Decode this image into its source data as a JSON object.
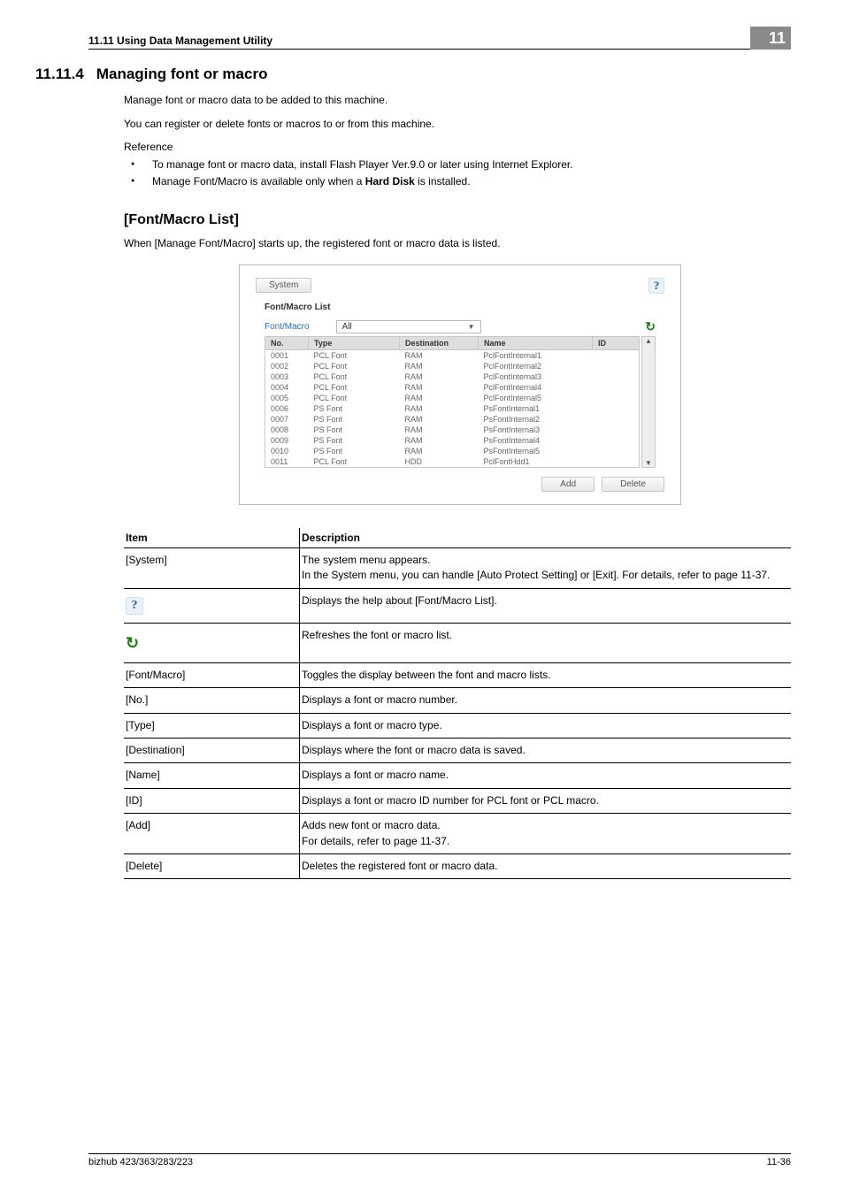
{
  "header": {
    "left": "11.11    Using Data Management Utility",
    "chip": "11"
  },
  "section": {
    "number": "11.11.4",
    "title": "Managing font or macro",
    "p1": "Manage font or macro data to be added to this machine.",
    "p2": "You can register or delete fonts or macros to or from this machine.",
    "ref_label": "Reference",
    "bul1": "To manage font or macro data, install Flash Player Ver.9.0 or later using Internet Explorer.",
    "bul2_a": "Manage Font/Macro is available only when a ",
    "bul2_b": "Hard Disk",
    "bul2_c": " is installed."
  },
  "subsection": {
    "title": "[Font/Macro List]",
    "p": "When [Manage Font/Macro] starts up, the registered font or macro data is listed."
  },
  "shot": {
    "system_btn": "System",
    "title": "Font/Macro List",
    "filter_link": "Font/Macro",
    "filter_value": "All",
    "add_btn": "Add",
    "del_btn": "Delete",
    "cols": {
      "no": "No.",
      "type": "Type",
      "dest": "Destination",
      "name": "Name",
      "id": "ID"
    },
    "rows": [
      {
        "no": "0001",
        "type": "PCL Font",
        "dest": "RAM",
        "name": "PclFontInternal1"
      },
      {
        "no": "0002",
        "type": "PCL Font",
        "dest": "RAM",
        "name": "PclFontInternal2"
      },
      {
        "no": "0003",
        "type": "PCL Font",
        "dest": "RAM",
        "name": "PclFontInternal3"
      },
      {
        "no": "0004",
        "type": "PCL Font",
        "dest": "RAM",
        "name": "PclFontInternal4"
      },
      {
        "no": "0005",
        "type": "PCL Font",
        "dest": "RAM",
        "name": "PclFontInternal5"
      },
      {
        "no": "0006",
        "type": "PS Font",
        "dest": "RAM",
        "name": "PsFontInternal1"
      },
      {
        "no": "0007",
        "type": "PS Font",
        "dest": "RAM",
        "name": "PsFontInternal2"
      },
      {
        "no": "0008",
        "type": "PS Font",
        "dest": "RAM",
        "name": "PsFontInternal3"
      },
      {
        "no": "0009",
        "type": "PS Font",
        "dest": "RAM",
        "name": "PsFontInternal4"
      },
      {
        "no": "0010",
        "type": "PS Font",
        "dest": "RAM",
        "name": "PsFontInternal5"
      },
      {
        "no": "0011",
        "type": "PCL Font",
        "dest": "HDD",
        "name": "PclFontHdd1"
      }
    ]
  },
  "desc": {
    "h_item": "Item",
    "h_desc": "Description",
    "rows": [
      {
        "item": "[System]",
        "desc": "The system menu appears.\nIn the System menu, you can handle [Auto Protect Setting] or [Exit]. For details, refer to page 11-37."
      },
      {
        "item": "__HELP_ICON__",
        "desc": "Displays the help about [Font/Macro List]."
      },
      {
        "item": "__REFRESH_ICON__",
        "desc": "Refreshes the font or macro list."
      },
      {
        "item": "[Font/Macro]",
        "desc": "Toggles the display between the font and macro lists."
      },
      {
        "item": "[No.]",
        "desc": "Displays a font or macro number."
      },
      {
        "item": "[Type]",
        "desc": "Displays a font or macro type."
      },
      {
        "item": "[Destination]",
        "desc": "Displays where the font or macro data is saved."
      },
      {
        "item": "[Name]",
        "desc": "Displays a font or macro name."
      },
      {
        "item": "[ID]",
        "desc": "Displays a font or macro ID number for PCL font or PCL macro."
      },
      {
        "item": "[Add]",
        "desc": "Adds new font or macro data.\nFor details, refer to page 11-37."
      },
      {
        "item": "[Delete]",
        "desc": "Deletes the registered font or macro data."
      }
    ]
  },
  "footer": {
    "left": "bizhub 423/363/283/223",
    "right": "11-36"
  }
}
